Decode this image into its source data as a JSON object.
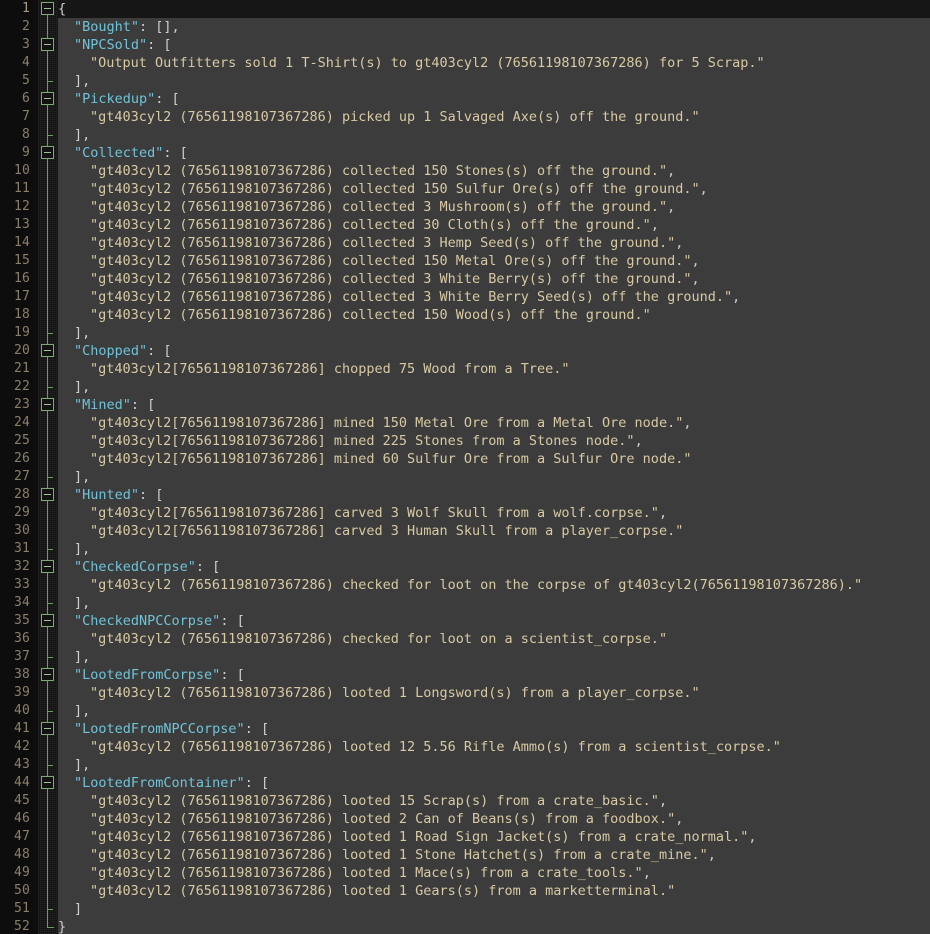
{
  "editor": {
    "app": "json-log-viewer",
    "language": "JSON",
    "colors": {
      "background": "#3c3c3c",
      "gutter_background": "#0d0d0d",
      "fold_gutter_background": "#121212",
      "active_line": "#161616",
      "line_number": "#8a7f6a",
      "key": "#6fc3d8",
      "string": "#d8c9a3",
      "punctuation": "#cfcfcf",
      "fold_marker": "#7fa972"
    },
    "first_line": 1,
    "last_line": 52,
    "active_line": 1,
    "line_height": 18
  },
  "lines": [
    {
      "n": 1,
      "indent": 0,
      "fold": "start",
      "tokens": [
        {
          "t": "p",
          "v": "{"
        }
      ]
    },
    {
      "n": 2,
      "indent": 1,
      "fold": "none",
      "tokens": [
        {
          "t": "k",
          "v": "\"Bought\""
        },
        {
          "t": "p",
          "v": ": [],"
        }
      ]
    },
    {
      "n": 3,
      "indent": 1,
      "fold": "start",
      "tokens": [
        {
          "t": "k",
          "v": "\"NPCSold\""
        },
        {
          "t": "p",
          "v": ": ["
        }
      ]
    },
    {
      "n": 4,
      "indent": 2,
      "fold": "none",
      "tokens": [
        {
          "t": "s",
          "v": "\"Output Outfitters sold 1 T-Shirt(s) to gt403cyl2 (76561198107367286) for 5 Scrap.\""
        }
      ]
    },
    {
      "n": 5,
      "indent": 1,
      "fold": "end",
      "tokens": [
        {
          "t": "p",
          "v": "],"
        }
      ]
    },
    {
      "n": 6,
      "indent": 1,
      "fold": "start",
      "tokens": [
        {
          "t": "k",
          "v": "\"Pickedup\""
        },
        {
          "t": "p",
          "v": ": ["
        }
      ]
    },
    {
      "n": 7,
      "indent": 2,
      "fold": "none",
      "tokens": [
        {
          "t": "s",
          "v": "\"gt403cyl2 (76561198107367286) picked up 1 Salvaged Axe(s) off the ground.\""
        }
      ]
    },
    {
      "n": 8,
      "indent": 1,
      "fold": "end",
      "tokens": [
        {
          "t": "p",
          "v": "],"
        }
      ]
    },
    {
      "n": 9,
      "indent": 1,
      "fold": "start",
      "tokens": [
        {
          "t": "k",
          "v": "\"Collected\""
        },
        {
          "t": "p",
          "v": ": ["
        }
      ]
    },
    {
      "n": 10,
      "indent": 2,
      "fold": "none",
      "tokens": [
        {
          "t": "s",
          "v": "\"gt403cyl2 (76561198107367286) collected 150 Stones(s) off the ground.\""
        },
        {
          "t": "p",
          "v": ","
        }
      ]
    },
    {
      "n": 11,
      "indent": 2,
      "fold": "none",
      "tokens": [
        {
          "t": "s",
          "v": "\"gt403cyl2 (76561198107367286) collected 150 Sulfur Ore(s) off the ground.\""
        },
        {
          "t": "p",
          "v": ","
        }
      ]
    },
    {
      "n": 12,
      "indent": 2,
      "fold": "none",
      "tokens": [
        {
          "t": "s",
          "v": "\"gt403cyl2 (76561198107367286) collected 3 Mushroom(s) off the ground.\""
        },
        {
          "t": "p",
          "v": ","
        }
      ]
    },
    {
      "n": 13,
      "indent": 2,
      "fold": "none",
      "tokens": [
        {
          "t": "s",
          "v": "\"gt403cyl2 (76561198107367286) collected 30 Cloth(s) off the ground.\""
        },
        {
          "t": "p",
          "v": ","
        }
      ]
    },
    {
      "n": 14,
      "indent": 2,
      "fold": "none",
      "tokens": [
        {
          "t": "s",
          "v": "\"gt403cyl2 (76561198107367286) collected 3 Hemp Seed(s) off the ground.\""
        },
        {
          "t": "p",
          "v": ","
        }
      ]
    },
    {
      "n": 15,
      "indent": 2,
      "fold": "none",
      "tokens": [
        {
          "t": "s",
          "v": "\"gt403cyl2 (76561198107367286) collected 150 Metal Ore(s) off the ground.\""
        },
        {
          "t": "p",
          "v": ","
        }
      ]
    },
    {
      "n": 16,
      "indent": 2,
      "fold": "none",
      "tokens": [
        {
          "t": "s",
          "v": "\"gt403cyl2 (76561198107367286) collected 3 White Berry(s) off the ground.\""
        },
        {
          "t": "p",
          "v": ","
        }
      ]
    },
    {
      "n": 17,
      "indent": 2,
      "fold": "none",
      "tokens": [
        {
          "t": "s",
          "v": "\"gt403cyl2 (76561198107367286) collected 3 White Berry Seed(s) off the ground.\""
        },
        {
          "t": "p",
          "v": ","
        }
      ]
    },
    {
      "n": 18,
      "indent": 2,
      "fold": "none",
      "tokens": [
        {
          "t": "s",
          "v": "\"gt403cyl2 (76561198107367286) collected 150 Wood(s) off the ground.\""
        }
      ]
    },
    {
      "n": 19,
      "indent": 1,
      "fold": "end",
      "tokens": [
        {
          "t": "p",
          "v": "],"
        }
      ]
    },
    {
      "n": 20,
      "indent": 1,
      "fold": "start",
      "tokens": [
        {
          "t": "k",
          "v": "\"Chopped\""
        },
        {
          "t": "p",
          "v": ": ["
        }
      ]
    },
    {
      "n": 21,
      "indent": 2,
      "fold": "none",
      "tokens": [
        {
          "t": "s",
          "v": "\"gt403cyl2[76561198107367286] chopped 75 Wood from a Tree.\""
        }
      ]
    },
    {
      "n": 22,
      "indent": 1,
      "fold": "end",
      "tokens": [
        {
          "t": "p",
          "v": "],"
        }
      ]
    },
    {
      "n": 23,
      "indent": 1,
      "fold": "start",
      "tokens": [
        {
          "t": "k",
          "v": "\"Mined\""
        },
        {
          "t": "p",
          "v": ": ["
        }
      ]
    },
    {
      "n": 24,
      "indent": 2,
      "fold": "none",
      "tokens": [
        {
          "t": "s",
          "v": "\"gt403cyl2[76561198107367286] mined 150 Metal Ore from a Metal Ore node.\""
        },
        {
          "t": "p",
          "v": ","
        }
      ]
    },
    {
      "n": 25,
      "indent": 2,
      "fold": "none",
      "tokens": [
        {
          "t": "s",
          "v": "\"gt403cyl2[76561198107367286] mined 225 Stones from a Stones node.\""
        },
        {
          "t": "p",
          "v": ","
        }
      ]
    },
    {
      "n": 26,
      "indent": 2,
      "fold": "none",
      "tokens": [
        {
          "t": "s",
          "v": "\"gt403cyl2[76561198107367286] mined 60 Sulfur Ore from a Sulfur Ore node.\""
        }
      ]
    },
    {
      "n": 27,
      "indent": 1,
      "fold": "end",
      "tokens": [
        {
          "t": "p",
          "v": "],"
        }
      ]
    },
    {
      "n": 28,
      "indent": 1,
      "fold": "start",
      "tokens": [
        {
          "t": "k",
          "v": "\"Hunted\""
        },
        {
          "t": "p",
          "v": ": ["
        }
      ]
    },
    {
      "n": 29,
      "indent": 2,
      "fold": "none",
      "tokens": [
        {
          "t": "s",
          "v": "\"gt403cyl2[76561198107367286] carved 3 Wolf Skull from a wolf.corpse.\""
        },
        {
          "t": "p",
          "v": ","
        }
      ]
    },
    {
      "n": 30,
      "indent": 2,
      "fold": "none",
      "tokens": [
        {
          "t": "s",
          "v": "\"gt403cyl2[76561198107367286] carved 3 Human Skull from a player_corpse.\""
        }
      ]
    },
    {
      "n": 31,
      "indent": 1,
      "fold": "end",
      "tokens": [
        {
          "t": "p",
          "v": "],"
        }
      ]
    },
    {
      "n": 32,
      "indent": 1,
      "fold": "start",
      "tokens": [
        {
          "t": "k",
          "v": "\"CheckedCorpse\""
        },
        {
          "t": "p",
          "v": ": ["
        }
      ]
    },
    {
      "n": 33,
      "indent": 2,
      "fold": "none",
      "tokens": [
        {
          "t": "s",
          "v": "\"gt403cyl2 (76561198107367286) checked for loot on the corpse of gt403cyl2(76561198107367286).\""
        }
      ]
    },
    {
      "n": 34,
      "indent": 1,
      "fold": "end",
      "tokens": [
        {
          "t": "p",
          "v": "],"
        }
      ]
    },
    {
      "n": 35,
      "indent": 1,
      "fold": "start",
      "tokens": [
        {
          "t": "k",
          "v": "\"CheckedNPCCorpse\""
        },
        {
          "t": "p",
          "v": ": ["
        }
      ]
    },
    {
      "n": 36,
      "indent": 2,
      "fold": "none",
      "tokens": [
        {
          "t": "s",
          "v": "\"gt403cyl2 (76561198107367286) checked for loot on a scientist_corpse.\""
        }
      ]
    },
    {
      "n": 37,
      "indent": 1,
      "fold": "end",
      "tokens": [
        {
          "t": "p",
          "v": "],"
        }
      ]
    },
    {
      "n": 38,
      "indent": 1,
      "fold": "start",
      "tokens": [
        {
          "t": "k",
          "v": "\"LootedFromCorpse\""
        },
        {
          "t": "p",
          "v": ": ["
        }
      ]
    },
    {
      "n": 39,
      "indent": 2,
      "fold": "none",
      "tokens": [
        {
          "t": "s",
          "v": "\"gt403cyl2 (76561198107367286) looted 1 Longsword(s) from a player_corpse.\""
        }
      ]
    },
    {
      "n": 40,
      "indent": 1,
      "fold": "end",
      "tokens": [
        {
          "t": "p",
          "v": "],"
        }
      ]
    },
    {
      "n": 41,
      "indent": 1,
      "fold": "start",
      "tokens": [
        {
          "t": "k",
          "v": "\"LootedFromNPCCorpse\""
        },
        {
          "t": "p",
          "v": ": ["
        }
      ]
    },
    {
      "n": 42,
      "indent": 2,
      "fold": "none",
      "tokens": [
        {
          "t": "s",
          "v": "\"gt403cyl2 (76561198107367286) looted 12 5.56 Rifle Ammo(s) from a scientist_corpse.\""
        }
      ]
    },
    {
      "n": 43,
      "indent": 1,
      "fold": "end",
      "tokens": [
        {
          "t": "p",
          "v": "],"
        }
      ]
    },
    {
      "n": 44,
      "indent": 1,
      "fold": "start",
      "tokens": [
        {
          "t": "k",
          "v": "\"LootedFromContainer\""
        },
        {
          "t": "p",
          "v": ": ["
        }
      ]
    },
    {
      "n": 45,
      "indent": 2,
      "fold": "none",
      "tokens": [
        {
          "t": "s",
          "v": "\"gt403cyl2 (76561198107367286) looted 15 Scrap(s) from a crate_basic.\""
        },
        {
          "t": "p",
          "v": ","
        }
      ]
    },
    {
      "n": 46,
      "indent": 2,
      "fold": "none",
      "tokens": [
        {
          "t": "s",
          "v": "\"gt403cyl2 (76561198107367286) looted 2 Can of Beans(s) from a foodbox.\""
        },
        {
          "t": "p",
          "v": ","
        }
      ]
    },
    {
      "n": 47,
      "indent": 2,
      "fold": "none",
      "tokens": [
        {
          "t": "s",
          "v": "\"gt403cyl2 (76561198107367286) looted 1 Road Sign Jacket(s) from a crate_normal.\""
        },
        {
          "t": "p",
          "v": ","
        }
      ]
    },
    {
      "n": 48,
      "indent": 2,
      "fold": "none",
      "tokens": [
        {
          "t": "s",
          "v": "\"gt403cyl2 (76561198107367286) looted 1 Stone Hatchet(s) from a crate_mine.\""
        },
        {
          "t": "p",
          "v": ","
        }
      ]
    },
    {
      "n": 49,
      "indent": 2,
      "fold": "none",
      "tokens": [
        {
          "t": "s",
          "v": "\"gt403cyl2 (76561198107367286) looted 1 Mace(s) from a crate_tools.\""
        },
        {
          "t": "p",
          "v": ","
        }
      ]
    },
    {
      "n": 50,
      "indent": 2,
      "fold": "none",
      "tokens": [
        {
          "t": "s",
          "v": "\"gt403cyl2 (76561198107367286) looted 1 Gears(s) from a marketterminal.\""
        }
      ]
    },
    {
      "n": 51,
      "indent": 1,
      "fold": "end",
      "tokens": [
        {
          "t": "p",
          "v": "]"
        }
      ]
    },
    {
      "n": 52,
      "indent": 0,
      "fold": "end-root",
      "tokens": [
        {
          "t": "p",
          "v": "}"
        }
      ]
    }
  ],
  "fold_segments": [
    {
      "from": 1,
      "to": 52
    },
    {
      "from": 3,
      "to": 5
    },
    {
      "from": 6,
      "to": 8
    },
    {
      "from": 9,
      "to": 19
    },
    {
      "from": 20,
      "to": 22
    },
    {
      "from": 23,
      "to": 27
    },
    {
      "from": 28,
      "to": 31
    },
    {
      "from": 32,
      "to": 34
    },
    {
      "from": 35,
      "to": 37
    },
    {
      "from": 38,
      "to": 40
    },
    {
      "from": 41,
      "to": 43
    },
    {
      "from": 44,
      "to": 51
    }
  ]
}
